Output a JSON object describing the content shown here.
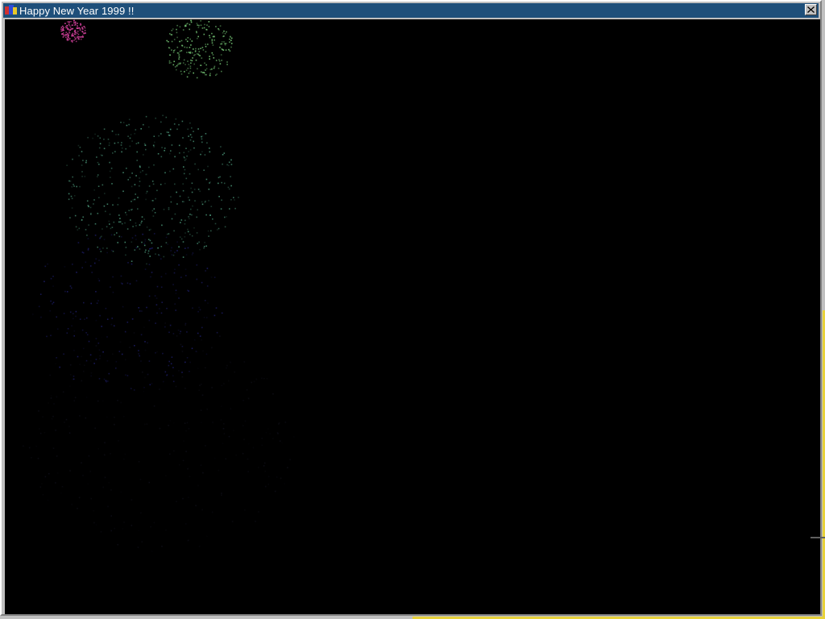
{
  "window": {
    "title": "Happy New Year 1999 !!",
    "icon": "app-icon",
    "close_icon": "close-icon"
  },
  "colors": {
    "titlebar": "#1e4f7a",
    "canvas": "#000000",
    "frame": "#c0c0c0",
    "resize_highlight": "#e8d23a"
  },
  "fireworks": [
    {
      "name": "burst-pink",
      "color": "#d0409a",
      "level": "bright"
    },
    {
      "name": "burst-green-top",
      "color": "#7bd07b",
      "level": "bright"
    },
    {
      "name": "burst-green-center",
      "color": "#5fbf9a",
      "level": "medium"
    },
    {
      "name": "burst-blue",
      "color": "#3a3ad0",
      "level": "faint"
    },
    {
      "name": "burst-trail",
      "color": "#303050",
      "level": "faint"
    }
  ]
}
